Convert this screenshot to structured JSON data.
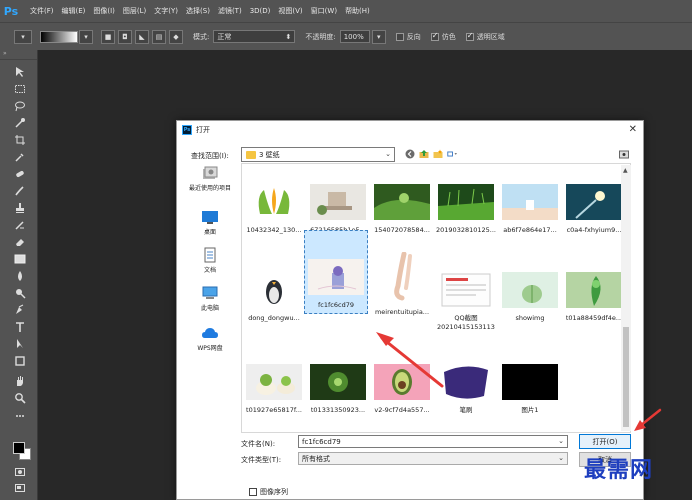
{
  "app": {
    "logo": "Ps",
    "menu": [
      "文件(F)",
      "编辑(E)",
      "图像(I)",
      "图层(L)",
      "文字(Y)",
      "选择(S)",
      "滤镜(T)",
      "3D(D)",
      "视图(V)",
      "窗口(W)",
      "帮助(H)"
    ]
  },
  "options": {
    "mode_label": "模式:",
    "mode_value": "正常",
    "opacity_label": "不透明度:",
    "opacity_value": "100%",
    "reverse_label": "反向",
    "dither_label": "仿色",
    "transparency_label": "透明区域"
  },
  "dialog": {
    "title": "打开",
    "look_in_label": "查找范围(I):",
    "look_in_value": "3 壁纸",
    "places": [
      "最近使用的项目",
      "桌面",
      "文档",
      "此电脑",
      "WPS网盘"
    ],
    "files": [
      {
        "name": "10432342_130..."
      },
      {
        "name": "67216585b1e5..."
      },
      {
        "name": "154072078584..."
      },
      {
        "name": "2019032810125..."
      },
      {
        "name": "ab6f7e864e17..."
      },
      {
        "name": "c0a4-fxhyium9..."
      },
      {
        "name": "dong_dongwu..."
      },
      {
        "name": "fc1fc6cd79"
      },
      {
        "name": "meirentuitupia..."
      },
      {
        "name": "QQ截图",
        "name2": "20210415153113"
      },
      {
        "name": "showimg"
      },
      {
        "name": "t01a88459df4e..."
      },
      {
        "name": "t01927e65817f..."
      },
      {
        "name": "t01331350923..."
      },
      {
        "name": "v2-9cf7d4a557..."
      },
      {
        "name": "笔刷"
      },
      {
        "name": "图片1"
      }
    ],
    "filename_label": "文件名(N):",
    "filename_value": "fc1fc6cd79",
    "filetype_label": "文件类型(T):",
    "filetype_value": "所有格式",
    "open_label": "打开(O)",
    "cancel_label": "取消",
    "sequence_label": "图像序列"
  },
  "watermark": "最需网",
  "colors": {
    "accent": "#31a8ff",
    "arrow": "#e53935",
    "selection": "#cce8ff",
    "watermark": "#1e3fbf"
  }
}
